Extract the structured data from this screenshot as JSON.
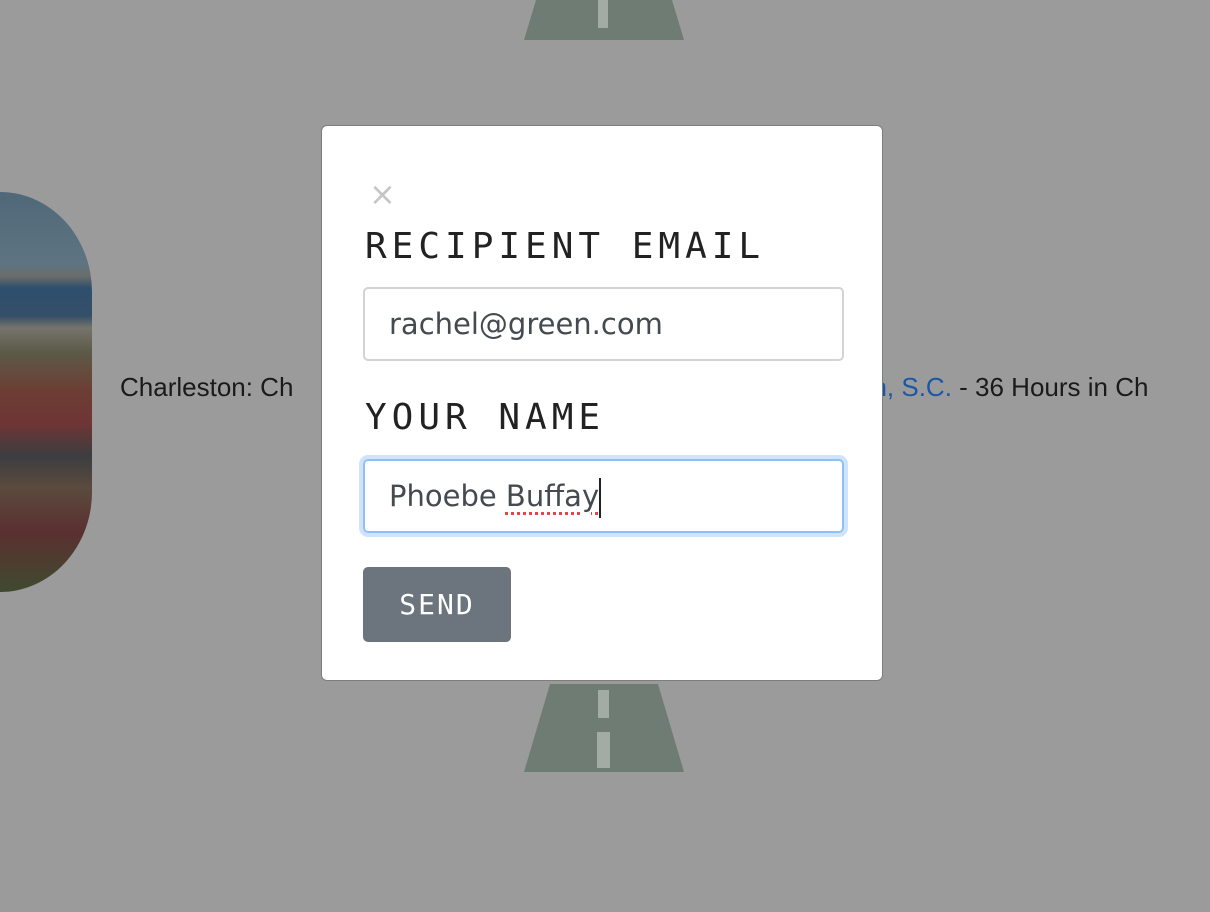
{
  "background": {
    "caption_prefix": "Charleston: Ch",
    "caption_link": "on, S.C.",
    "caption_suffix": " - 36 Hours in Ch"
  },
  "modal": {
    "close_label": "×",
    "recipient_label": "RECIPIENT EMAIL",
    "recipient_value": "rachel@green.com",
    "name_label": "YOUR NAME",
    "name_value_first": "Phoebe ",
    "name_value_last": "Buffay",
    "send_label": "SEND"
  },
  "colors": {
    "overlay": "#9b9b9b",
    "button": "#6c757d",
    "link": "#1a57a6",
    "road": "#6f7c73"
  }
}
